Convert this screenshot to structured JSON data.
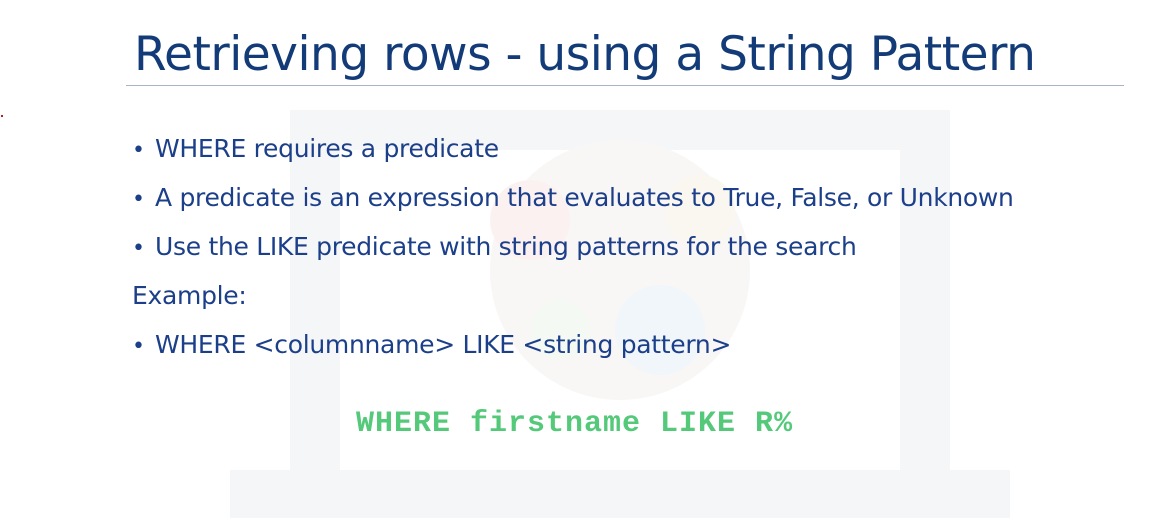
{
  "slide": {
    "title": "Retrieving rows - using a String Pattern",
    "bullets_top": [
      "WHERE requires a predicate",
      "A predicate is an expression that evaluates to True, False, or Unknown",
      "Use the LIKE predicate with string patterns for the search"
    ],
    "example_label": "Example:",
    "bullets_bottom": [
      "WHERE <columnname> LIKE <string pattern>"
    ],
    "bullet_glyph": "•",
    "code_example": "WHERE firstname LIKE R%"
  },
  "colors": {
    "title": "#133b78",
    "body_text": "#1c3f8a",
    "code": "#55c97a",
    "rule": "#aab3c5"
  }
}
